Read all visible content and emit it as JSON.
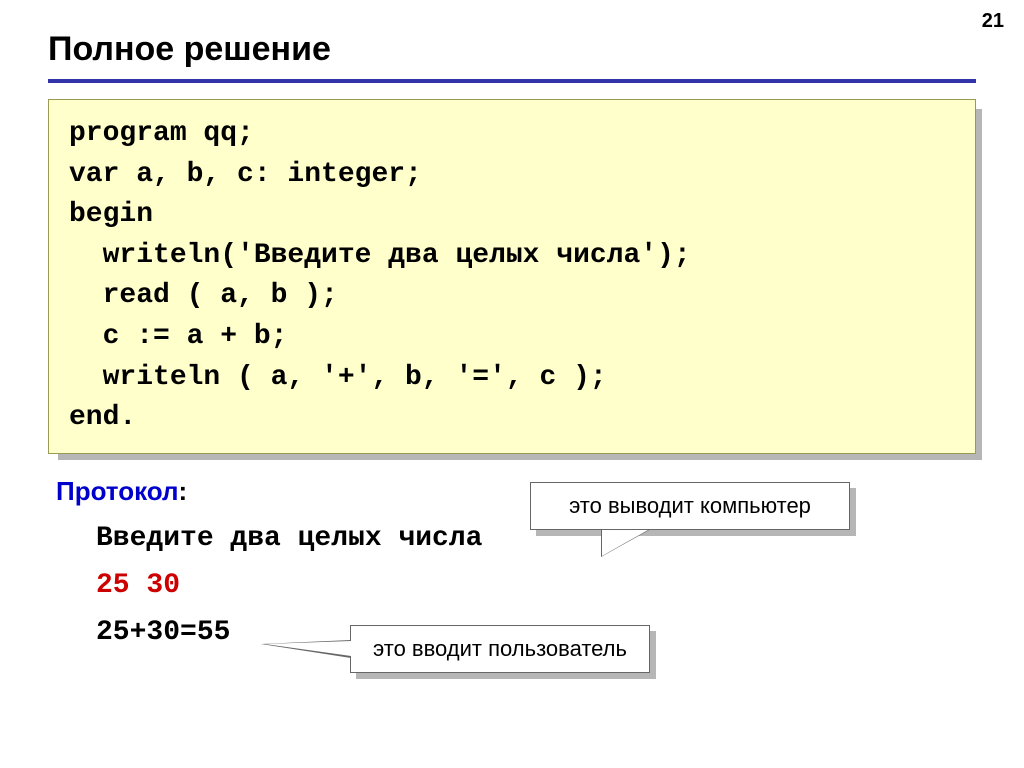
{
  "page_number": "21",
  "title": "Полное решение",
  "code": {
    "l1": "program qq;",
    "l2": "var a, b, c: integer;",
    "l3": "begin",
    "l4": "  writeln('Введите два целых числа');",
    "l5": "  read ( a, b );",
    "l6": "  c := a + b;",
    "l7": "  writeln ( a, '+', b, '=', c );",
    "l8": "end."
  },
  "protocol": {
    "label_word": "Протокол",
    "label_colon": ":",
    "line1": "Введите два целых числа",
    "line2": "25 30",
    "line3": "25+30=55"
  },
  "callouts": {
    "computer": "это выводит компьютер",
    "user": "это вводит пользователь"
  }
}
